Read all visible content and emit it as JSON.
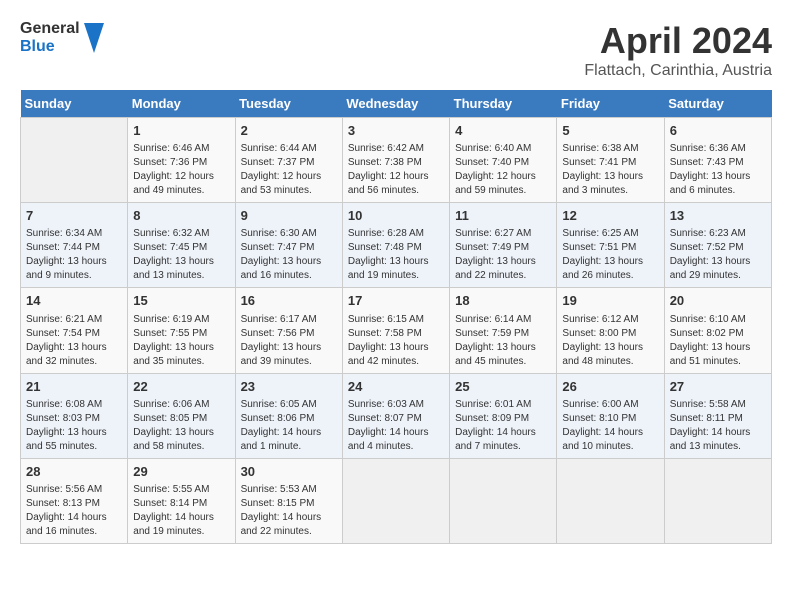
{
  "header": {
    "logo_line1": "General",
    "logo_line2": "Blue",
    "title": "April 2024",
    "subtitle": "Flattach, Carinthia, Austria"
  },
  "calendar": {
    "weekdays": [
      "Sunday",
      "Monday",
      "Tuesday",
      "Wednesday",
      "Thursday",
      "Friday",
      "Saturday"
    ],
    "weeks": [
      [
        {
          "day": "",
          "info": ""
        },
        {
          "day": "1",
          "info": "Sunrise: 6:46 AM\nSunset: 7:36 PM\nDaylight: 12 hours\nand 49 minutes."
        },
        {
          "day": "2",
          "info": "Sunrise: 6:44 AM\nSunset: 7:37 PM\nDaylight: 12 hours\nand 53 minutes."
        },
        {
          "day": "3",
          "info": "Sunrise: 6:42 AM\nSunset: 7:38 PM\nDaylight: 12 hours\nand 56 minutes."
        },
        {
          "day": "4",
          "info": "Sunrise: 6:40 AM\nSunset: 7:40 PM\nDaylight: 12 hours\nand 59 minutes."
        },
        {
          "day": "5",
          "info": "Sunrise: 6:38 AM\nSunset: 7:41 PM\nDaylight: 13 hours\nand 3 minutes."
        },
        {
          "day": "6",
          "info": "Sunrise: 6:36 AM\nSunset: 7:43 PM\nDaylight: 13 hours\nand 6 minutes."
        }
      ],
      [
        {
          "day": "7",
          "info": "Sunrise: 6:34 AM\nSunset: 7:44 PM\nDaylight: 13 hours\nand 9 minutes."
        },
        {
          "day": "8",
          "info": "Sunrise: 6:32 AM\nSunset: 7:45 PM\nDaylight: 13 hours\nand 13 minutes."
        },
        {
          "day": "9",
          "info": "Sunrise: 6:30 AM\nSunset: 7:47 PM\nDaylight: 13 hours\nand 16 minutes."
        },
        {
          "day": "10",
          "info": "Sunrise: 6:28 AM\nSunset: 7:48 PM\nDaylight: 13 hours\nand 19 minutes."
        },
        {
          "day": "11",
          "info": "Sunrise: 6:27 AM\nSunset: 7:49 PM\nDaylight: 13 hours\nand 22 minutes."
        },
        {
          "day": "12",
          "info": "Sunrise: 6:25 AM\nSunset: 7:51 PM\nDaylight: 13 hours\nand 26 minutes."
        },
        {
          "day": "13",
          "info": "Sunrise: 6:23 AM\nSunset: 7:52 PM\nDaylight: 13 hours\nand 29 minutes."
        }
      ],
      [
        {
          "day": "14",
          "info": "Sunrise: 6:21 AM\nSunset: 7:54 PM\nDaylight: 13 hours\nand 32 minutes."
        },
        {
          "day": "15",
          "info": "Sunrise: 6:19 AM\nSunset: 7:55 PM\nDaylight: 13 hours\nand 35 minutes."
        },
        {
          "day": "16",
          "info": "Sunrise: 6:17 AM\nSunset: 7:56 PM\nDaylight: 13 hours\nand 39 minutes."
        },
        {
          "day": "17",
          "info": "Sunrise: 6:15 AM\nSunset: 7:58 PM\nDaylight: 13 hours\nand 42 minutes."
        },
        {
          "day": "18",
          "info": "Sunrise: 6:14 AM\nSunset: 7:59 PM\nDaylight: 13 hours\nand 45 minutes."
        },
        {
          "day": "19",
          "info": "Sunrise: 6:12 AM\nSunset: 8:00 PM\nDaylight: 13 hours\nand 48 minutes."
        },
        {
          "day": "20",
          "info": "Sunrise: 6:10 AM\nSunset: 8:02 PM\nDaylight: 13 hours\nand 51 minutes."
        }
      ],
      [
        {
          "day": "21",
          "info": "Sunrise: 6:08 AM\nSunset: 8:03 PM\nDaylight: 13 hours\nand 55 minutes."
        },
        {
          "day": "22",
          "info": "Sunrise: 6:06 AM\nSunset: 8:05 PM\nDaylight: 13 hours\nand 58 minutes."
        },
        {
          "day": "23",
          "info": "Sunrise: 6:05 AM\nSunset: 8:06 PM\nDaylight: 14 hours\nand 1 minute."
        },
        {
          "day": "24",
          "info": "Sunrise: 6:03 AM\nSunset: 8:07 PM\nDaylight: 14 hours\nand 4 minutes."
        },
        {
          "day": "25",
          "info": "Sunrise: 6:01 AM\nSunset: 8:09 PM\nDaylight: 14 hours\nand 7 minutes."
        },
        {
          "day": "26",
          "info": "Sunrise: 6:00 AM\nSunset: 8:10 PM\nDaylight: 14 hours\nand 10 minutes."
        },
        {
          "day": "27",
          "info": "Sunrise: 5:58 AM\nSunset: 8:11 PM\nDaylight: 14 hours\nand 13 minutes."
        }
      ],
      [
        {
          "day": "28",
          "info": "Sunrise: 5:56 AM\nSunset: 8:13 PM\nDaylight: 14 hours\nand 16 minutes."
        },
        {
          "day": "29",
          "info": "Sunrise: 5:55 AM\nSunset: 8:14 PM\nDaylight: 14 hours\nand 19 minutes."
        },
        {
          "day": "30",
          "info": "Sunrise: 5:53 AM\nSunset: 8:15 PM\nDaylight: 14 hours\nand 22 minutes."
        },
        {
          "day": "",
          "info": ""
        },
        {
          "day": "",
          "info": ""
        },
        {
          "day": "",
          "info": ""
        },
        {
          "day": "",
          "info": ""
        }
      ]
    ]
  }
}
